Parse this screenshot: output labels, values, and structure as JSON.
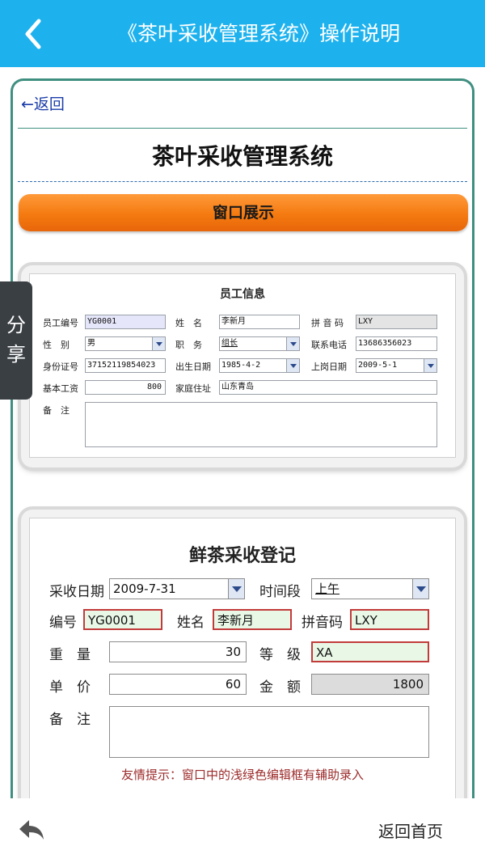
{
  "header": {
    "title": "《茶叶采收管理系统》操作说明"
  },
  "content": {
    "back_link": "←返回",
    "page_title": "茶叶采收管理系统",
    "section_title": "窗口展示"
  },
  "employee_form": {
    "title": "员工信息",
    "fields": {
      "emp_id_label": "员工编号",
      "emp_id": "YG0001",
      "name_label": "姓　名",
      "name": "李新月",
      "pinyin_label": "拼 音 码",
      "pinyin": "LXY",
      "gender_label": "性　别",
      "gender": "男",
      "position_label": "职　务",
      "position": "组长",
      "phone_label": "联系电话",
      "phone": "13686356023",
      "idcard_label": "身份证号",
      "idcard": "37152119854023",
      "birth_label": "出生日期",
      "birth": "1985-4-2",
      "hire_label": "上岗日期",
      "hire": "2009-5-1",
      "salary_label": "基本工资",
      "salary": "800",
      "address_label": "家庭住址",
      "address": "山东青岛",
      "remark_label": "备　注"
    }
  },
  "harvest_form": {
    "title": "鲜茶采收登记",
    "fields": {
      "date_label": "采收日期",
      "date": "2009-7-31",
      "period_label": "时间段",
      "period": "上午",
      "code_label": "编号",
      "code": "YG0001",
      "name_label": "姓名",
      "name": "李新月",
      "pinyin_label": "拼音码",
      "pinyin": "LXY",
      "weight_label": "重　量",
      "weight": "30",
      "grade_label": "等　级",
      "grade": "XA",
      "price_label": "单　价",
      "price": "60",
      "amount_label": "金　额",
      "amount": "1800",
      "remark_label": "备　注"
    },
    "tip": "友情提示：窗口中的浅绿色编辑框有辅助录入"
  },
  "share_tab": {
    "char1": "分",
    "char2": "享"
  },
  "footer": {
    "home_label": "返回首页"
  },
  "colors": {
    "accent": "#1db2ee",
    "section_bar": "#f47a10",
    "frame_border": "#3f8f80"
  }
}
